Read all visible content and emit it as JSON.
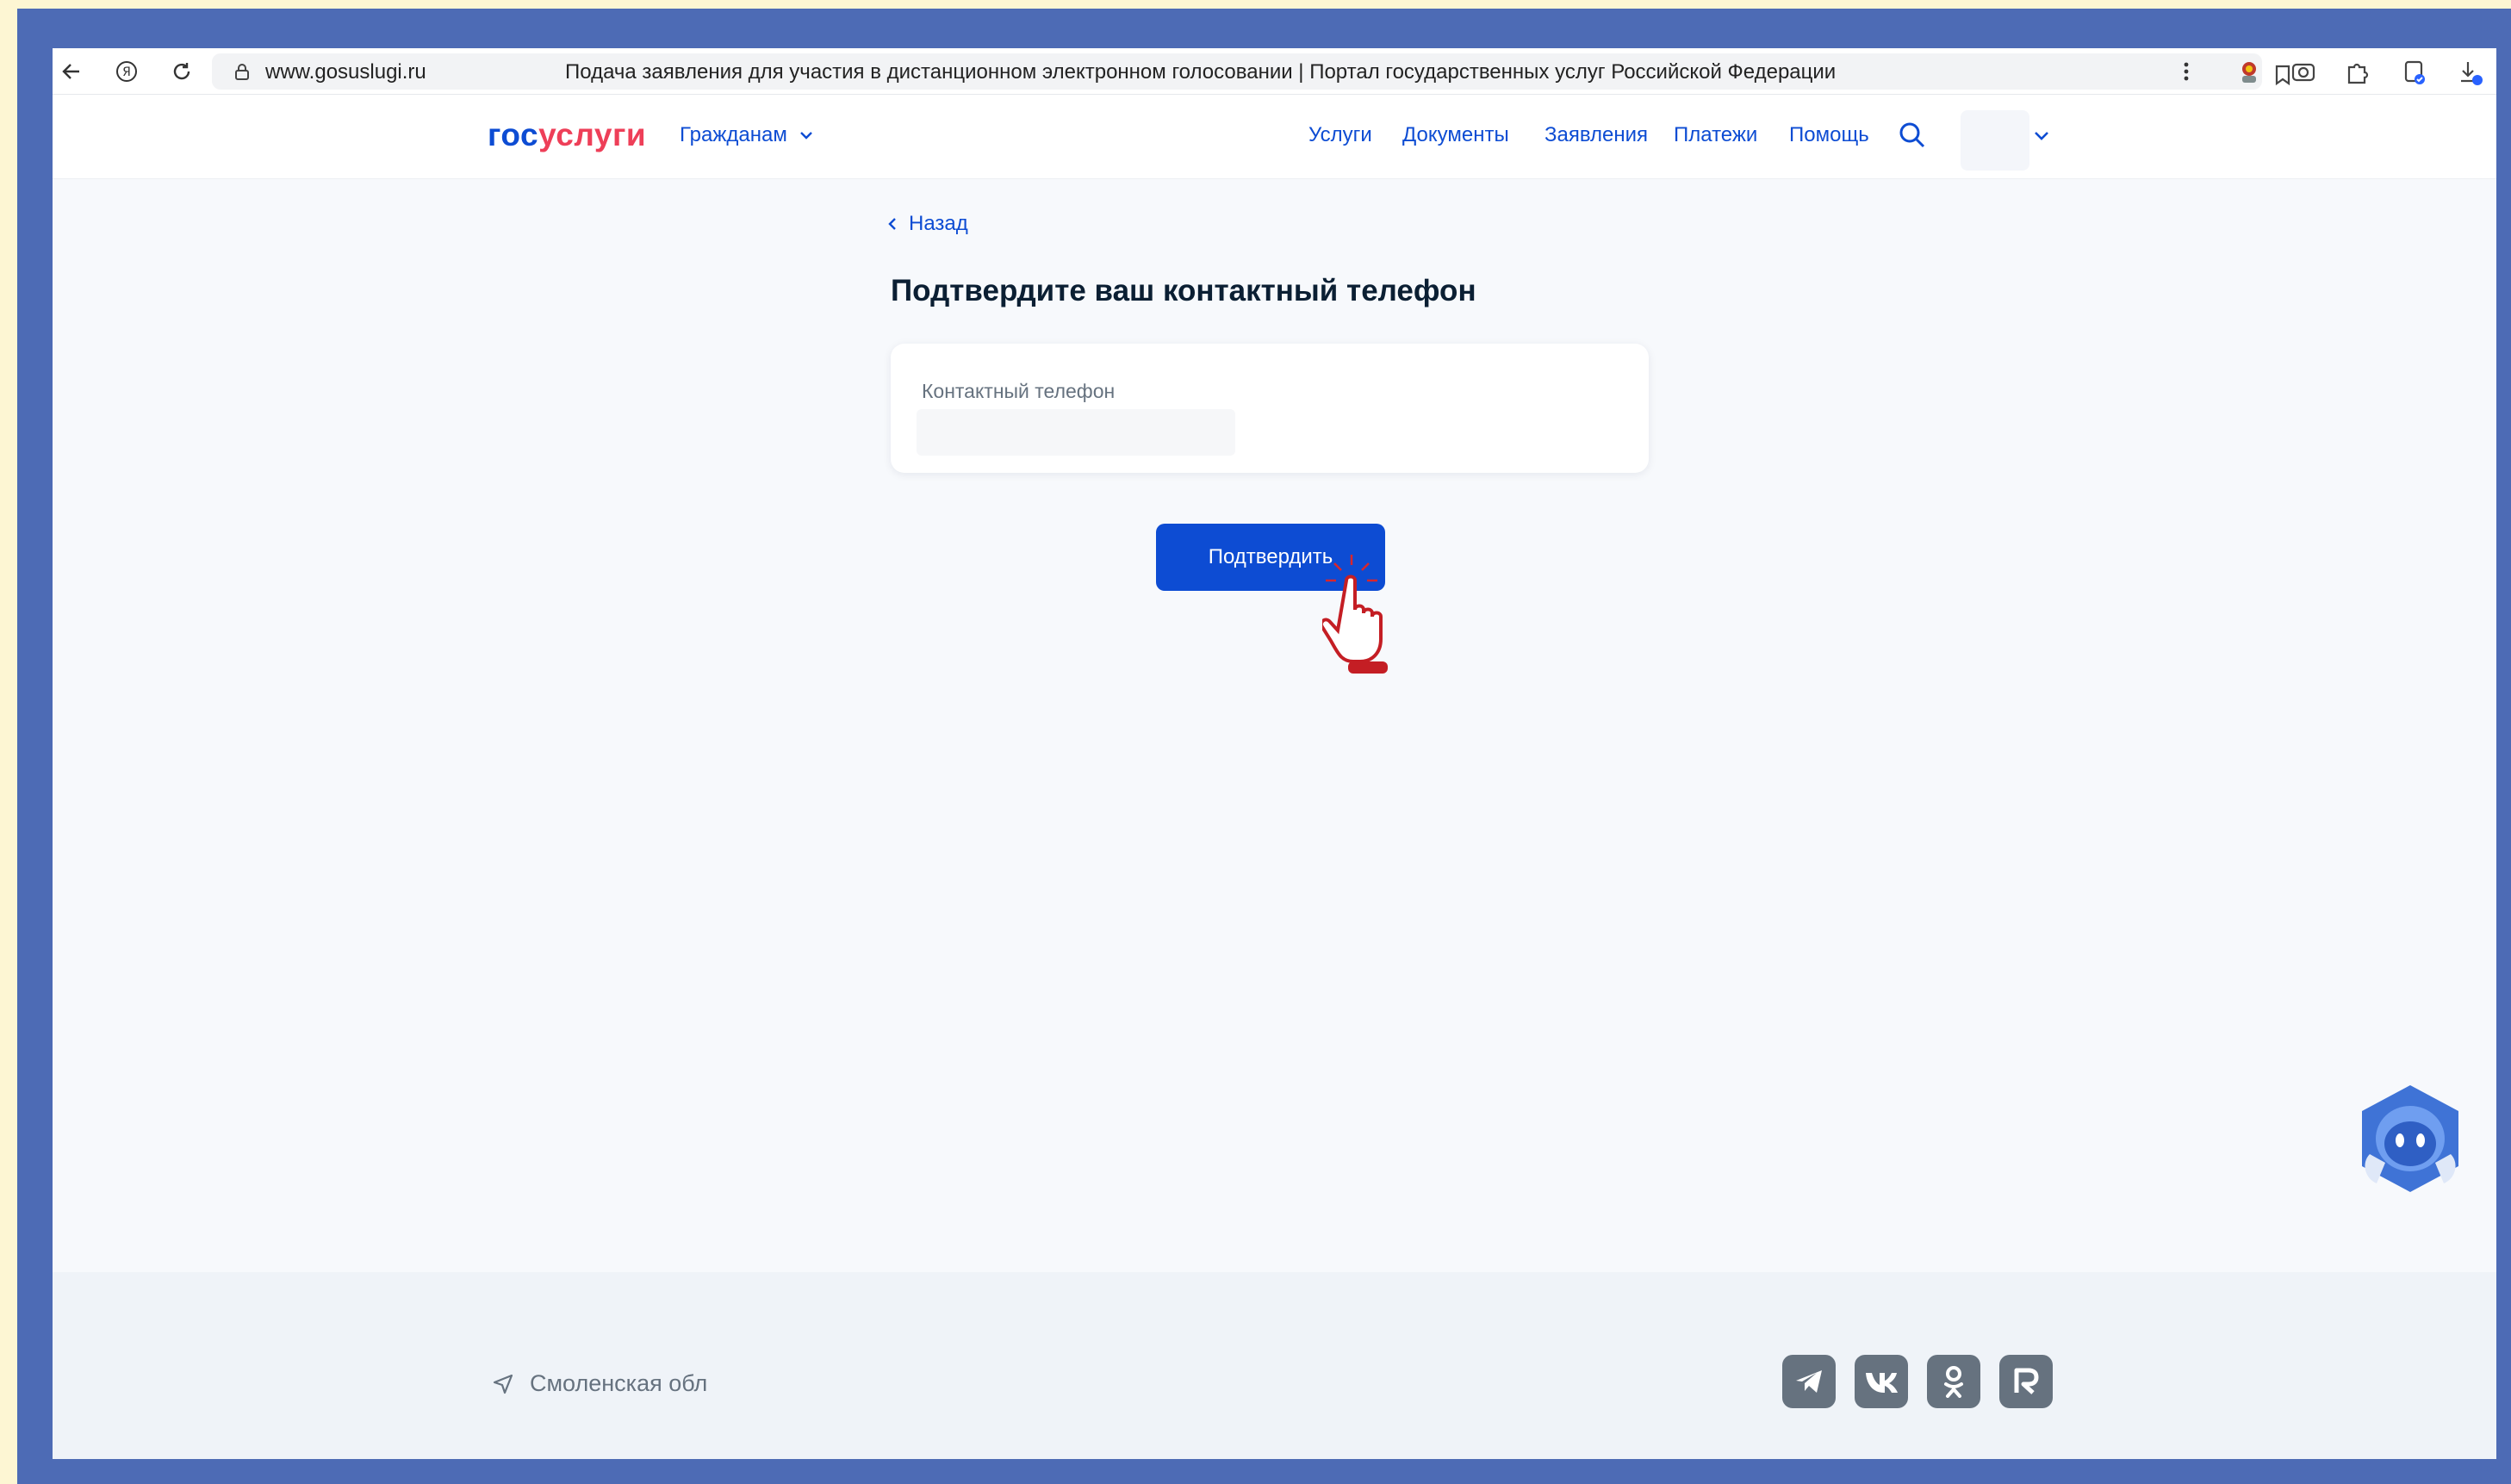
{
  "browser": {
    "url": "www.gosuslugi.ru",
    "title": "Подача заявления для участия в дистанционном электронном голосовании | Портал государственных услуг Российской Федерации",
    "icons": [
      "back-arrow-icon",
      "yandex-icon",
      "reload-icon",
      "lock-icon",
      "bookmark-icon",
      "menu-dots-icon",
      "extension-icons",
      "download-icon"
    ]
  },
  "header": {
    "logo_part1": "гос",
    "logo_part2": "услуги",
    "audience": "Гражданам",
    "nav": [
      "Услуги",
      "Документы",
      "Заявления",
      "Платежи",
      "Помощь"
    ]
  },
  "main": {
    "back_label": "Назад",
    "heading": "Подтвердите ваш контактный телефон",
    "field_label": "Контактный телефон",
    "field_value": "",
    "confirm_label": "Подтвердить"
  },
  "footer": {
    "region": "Смоленская обл",
    "socials": [
      "telegram-icon",
      "vk-icon",
      "odnoklassniki-icon",
      "rutube-icon"
    ]
  },
  "colors": {
    "brand_blue": "#0d4cd3",
    "brand_red": "#ee3f58",
    "frame": "#4d6bb5",
    "text_dark": "#0b1f33",
    "text_muted": "#66727f"
  }
}
